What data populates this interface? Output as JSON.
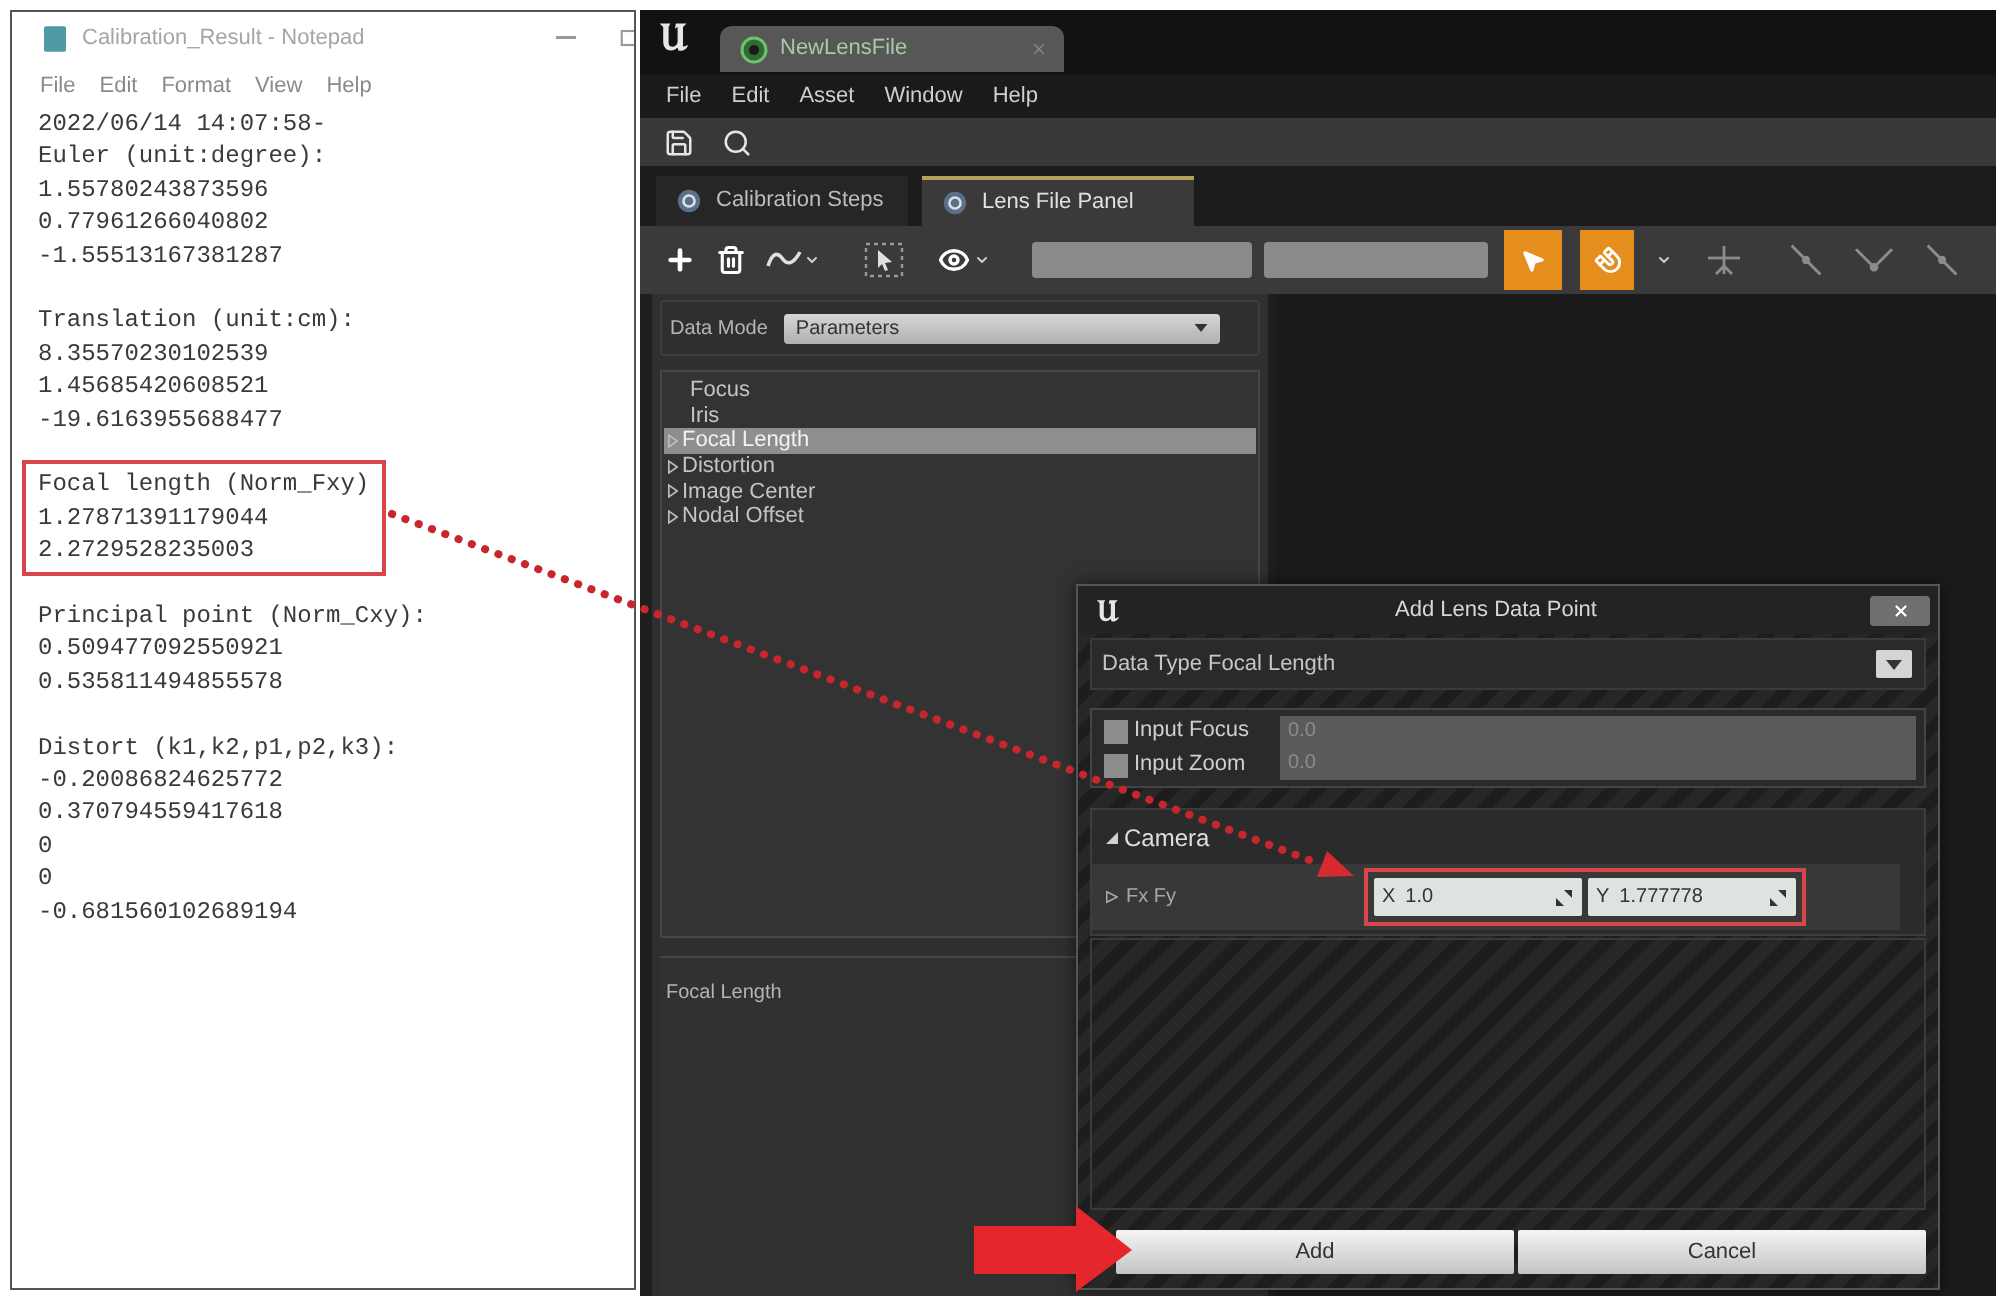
{
  "notepad": {
    "title": "Calibration_Result - Notepad",
    "menu": [
      "File",
      "Edit",
      "Format",
      "View",
      "Help"
    ],
    "blocks": [
      {
        "highlighted": false,
        "lines": [
          "2022/06/14 14:07:58-",
          "Euler (unit:degree):",
          "1.55780243873596",
          "0.77961266040802",
          "-1.55513167381287"
        ]
      },
      {
        "highlighted": false,
        "lines": [
          "Translation (unit:cm):",
          "8.35570230102539",
          "1.45685420608521",
          "-19.6163955688477"
        ]
      },
      {
        "highlighted": true,
        "lines": [
          "Focal length (Norm_Fxy)",
          "1.27871391179044",
          "2.2729528235003"
        ]
      },
      {
        "highlighted": false,
        "lines": [
          "Principal point (Norm_Cxy):",
          "0.509477092550921",
          "0.535811494855578"
        ]
      },
      {
        "highlighted": false,
        "lines": [
          "Distort (k1,k2,p1,p2,k3):",
          "-0.20086824625772",
          "0.370794559417618",
          "0",
          "0",
          "-0.681560102689194"
        ]
      }
    ]
  },
  "editor": {
    "asset_tab": "NewLensFile",
    "menu": [
      "File",
      "Edit",
      "Asset",
      "Window",
      "Help"
    ],
    "panel_tabs": [
      {
        "label": "Calibration Steps",
        "selected": false
      },
      {
        "label": "Lens File Panel",
        "selected": true
      }
    ],
    "curve_tools": [
      {
        "active": true
      },
      {
        "active": true
      }
    ],
    "data_mode": {
      "label": "Data Mode",
      "value": "Parameters"
    },
    "tree": [
      {
        "label": "Focus",
        "expandable": false,
        "selected": false
      },
      {
        "label": "Iris",
        "expandable": false,
        "selected": false
      },
      {
        "label": "Focal Length",
        "expandable": true,
        "selected": true
      },
      {
        "label": "Distortion",
        "expandable": true,
        "selected": false
      },
      {
        "label": "Image Center",
        "expandable": true,
        "selected": false
      },
      {
        "label": "Nodal Offset",
        "expandable": true,
        "selected": false
      }
    ],
    "details_title": "Focal Length"
  },
  "dialog": {
    "title": "Add Lens Data Point",
    "data_type": "Data Type Focal Length",
    "inputs": [
      {
        "label": "Input Focus",
        "checked": false,
        "value": "0.0"
      },
      {
        "label": "Input Zoom",
        "checked": false,
        "value": "0.0"
      }
    ],
    "category": {
      "label": "Camera",
      "expanded": true
    },
    "property": {
      "label": "Fx Fy",
      "expanded": false,
      "highlighted": true,
      "fields": [
        {
          "axis": "X",
          "value": "1.0"
        },
        {
          "axis": "Y",
          "value": "1.777778"
        }
      ]
    },
    "buttons": [
      "Add",
      "Cancel"
    ]
  }
}
